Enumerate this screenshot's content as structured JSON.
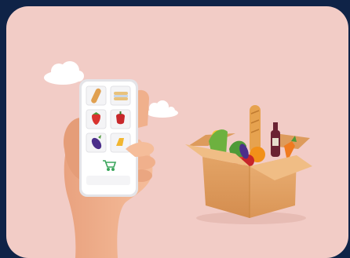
{
  "scene": {
    "background_color": "#f2ccc6",
    "frame_color": "#0f2347",
    "phone_items": [
      "baguette-icon",
      "sandwich-icon",
      "strawberry-icon",
      "apple-icon",
      "eggplant-icon",
      "cheese-icon"
    ],
    "cart_icon": "shopping-cart-icon",
    "box_contents": [
      "baguette",
      "corn",
      "bell-pepper",
      "orange",
      "tomato",
      "wine-bottle",
      "carrot",
      "greens",
      "eggplant",
      "cheese"
    ]
  }
}
